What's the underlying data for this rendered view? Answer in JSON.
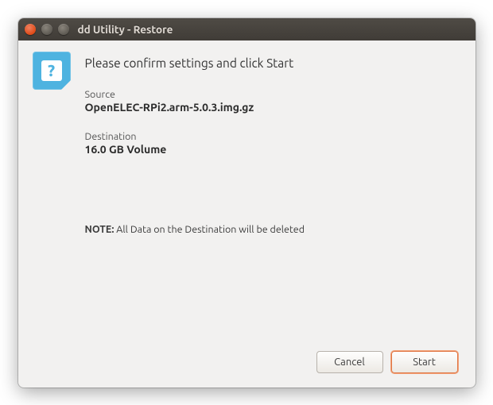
{
  "window": {
    "title": "dd Utility - Restore"
  },
  "dialog": {
    "heading": "Please confirm settings and click Start",
    "source_label": "Source",
    "source_value": "OpenELEC-RPi2.arm-5.0.3.img.gz",
    "destination_label": "Destination",
    "destination_value": "16.0 GB Volume",
    "note_prefix": "NOTE:",
    "note_text": " All Data on the Destination will be deleted"
  },
  "buttons": {
    "cancel": "Cancel",
    "start": "Start"
  }
}
